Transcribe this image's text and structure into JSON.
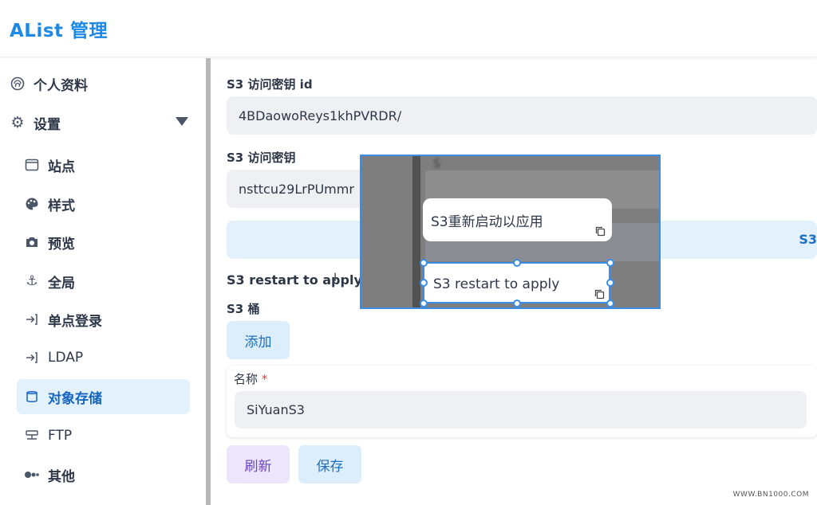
{
  "app": {
    "title": "AList 管理"
  },
  "sidebar": {
    "items": [
      {
        "label": "个人资料",
        "icon": "fingerprint-icon"
      },
      {
        "label": "设置",
        "icon": "gear-icon"
      },
      {
        "label": "站点",
        "icon": "window-icon"
      },
      {
        "label": "样式",
        "icon": "palette-icon"
      },
      {
        "label": "预览",
        "icon": "camera-icon"
      },
      {
        "label": "全局",
        "icon": "anchor-icon"
      },
      {
        "label": "单点登录",
        "icon": "login-icon"
      },
      {
        "label": "LDAP",
        "icon": "login-icon"
      },
      {
        "label": "对象存储",
        "icon": "database-icon"
      },
      {
        "label": "FTP",
        "icon": "server-icon"
      },
      {
        "label": "其他",
        "icon": "toggle-icon"
      }
    ],
    "active": "对象存储"
  },
  "main": {
    "access_key_id_label": "S3 访问密钥 id",
    "access_key_id_value": "4BDaowoReys1khPVRDR/",
    "secret_label": "S3 访问密钥",
    "secret_value": "nsttcu29LrPUmmr",
    "info_bar_text": "S3",
    "restart_hint": "S3 restart to apply",
    "bucket_label": "S3 桶",
    "add_button": "添加",
    "name_label": "名称",
    "name_required_mark": "*",
    "name_value": "SiYuanS3",
    "refresh_button": "刷新",
    "save_button": "保存"
  },
  "popup": {
    "bubble_zh": "S3重新启动以应用",
    "bubble_en": "S3 restart to apply",
    "blurred_label": "S"
  },
  "watermark": "WWW.BN1000.COM",
  "colors": {
    "accent": "#1e88e5",
    "active_bg": "#e3f1fc",
    "selection": "#3b8ee8"
  }
}
